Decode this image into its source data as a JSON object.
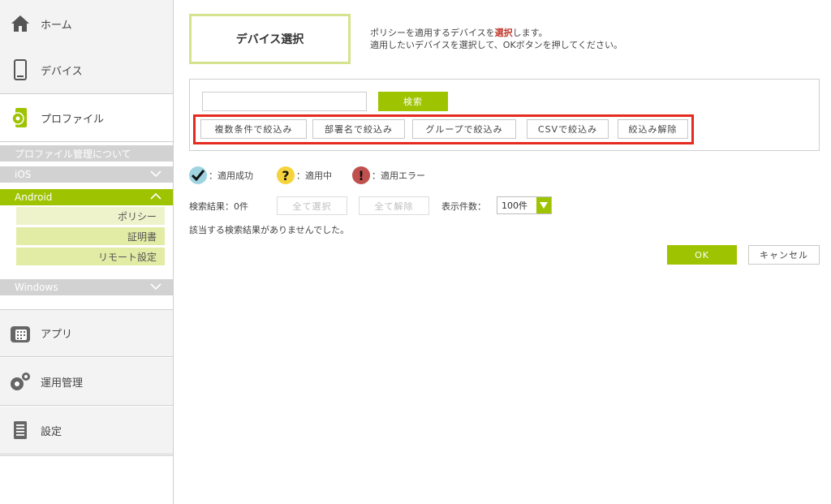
{
  "sidebar": {
    "home": "ホーム",
    "device": "デバイス",
    "profile": "プロファイル",
    "profile_about": "プロファイル管理について",
    "ios": "iOS",
    "android": "Android",
    "android_items": [
      "ポリシー",
      "証明書",
      "リモート設定"
    ],
    "windows": "Windows",
    "app": "アプリ",
    "operations": "運用管理",
    "settings": "設定"
  },
  "main": {
    "title": "デバイス選択",
    "desc_line1_pre": "ポリシーを適用するデバイスを",
    "desc_line1_hl": "選択",
    "desc_line1_post": "します。",
    "desc_line2": "適用したいデバイスを選択して、OKボタンを押してください。",
    "search_value": "",
    "search_button": "検索",
    "filters": [
      "複数条件で絞込み",
      "部署名で絞込み",
      "グループで絞込み",
      "CSVで絞込み",
      "絞込み解除"
    ],
    "legend": {
      "success": "：適用成功",
      "applying": "：適用中",
      "error": "：適用エラー"
    },
    "result_count": "検索結果：0件",
    "select_all": "全て選択",
    "deselect_all": "全て解除",
    "per_page_label": "表示件数：",
    "per_page_value": "100件",
    "no_results": "該当する検索結果がありませんでした。",
    "ok": "OK",
    "cancel": "キャンセル"
  },
  "colors": {
    "accent_green": "#9ec300",
    "highlight_red": "#e42b1e",
    "success": "#9fd3e0",
    "applying": "#f5d33a",
    "error": "#c0504d"
  }
}
